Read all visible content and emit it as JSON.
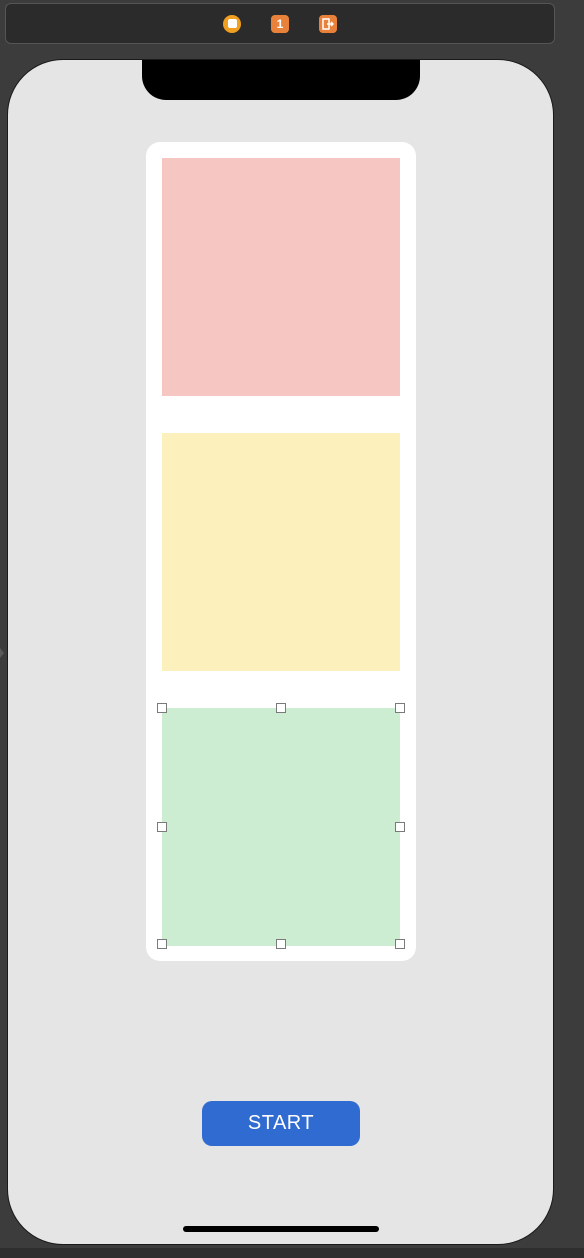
{
  "scene_dock": {
    "icons": [
      "view-controller-icon",
      "first-responder-icon",
      "exit-icon"
    ],
    "first_responder_label": "1"
  },
  "colors": {
    "red_light": "#f6c6c3",
    "yellow_light": "#fcf1bd",
    "green_light": "#ccedd1",
    "button": "#2f6bd0"
  },
  "button": {
    "label": "START"
  }
}
